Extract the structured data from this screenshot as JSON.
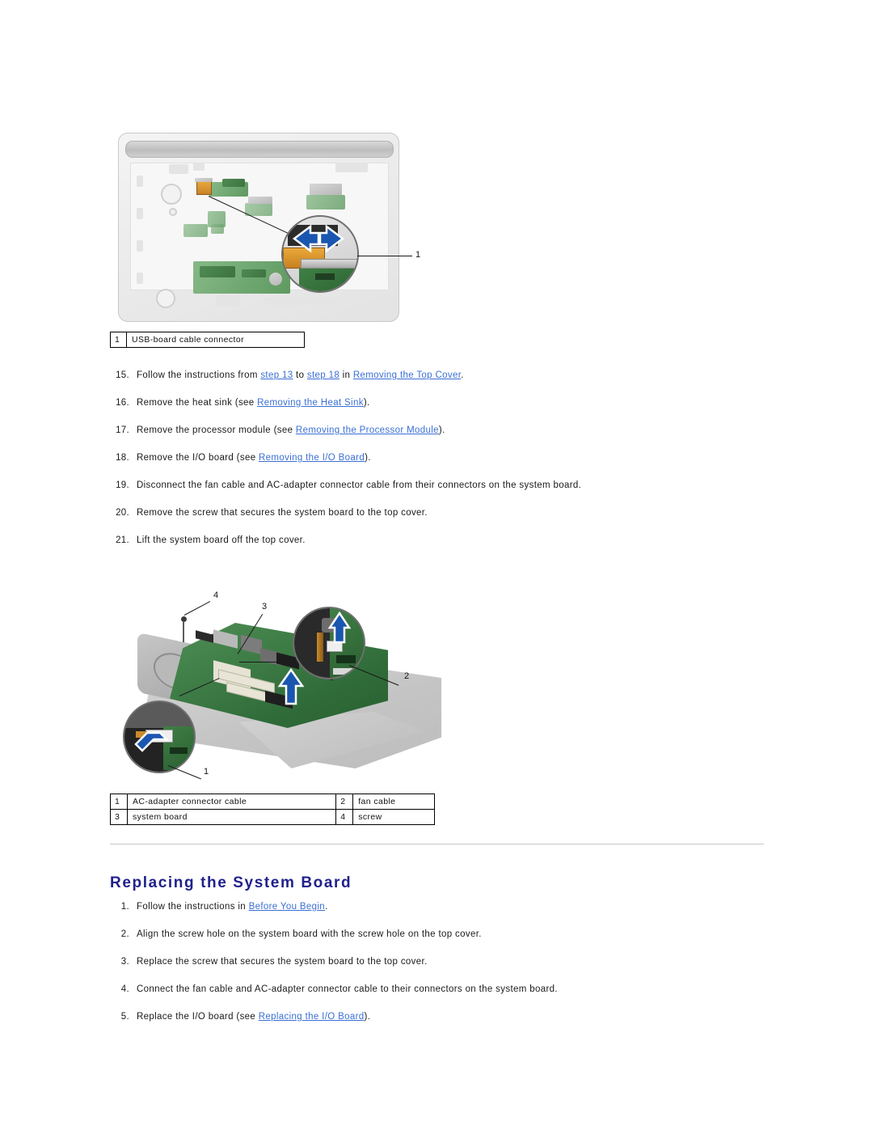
{
  "figure_one": {
    "caption_table": {
      "rows": [
        {
          "index": "1",
          "label": "USB-board cable connector"
        }
      ]
    },
    "callouts": [
      "1"
    ]
  },
  "removal_steps": [
    {
      "num": "15.",
      "segments": [
        {
          "type": "text",
          "text": "Follow the instructions from "
        },
        {
          "type": "link",
          "text": "step 13"
        },
        {
          "type": "text",
          "text": " to "
        },
        {
          "type": "link",
          "text": "step 18"
        },
        {
          "type": "text",
          "text": " in "
        },
        {
          "type": "link",
          "text": "Removing the Top Cover"
        },
        {
          "type": "text",
          "text": "."
        }
      ]
    },
    {
      "num": "16.",
      "segments": [
        {
          "type": "text",
          "text": "Remove the heat sink (see "
        },
        {
          "type": "link",
          "text": "Removing the Heat Sink"
        },
        {
          "type": "text",
          "text": ")."
        }
      ]
    },
    {
      "num": "17.",
      "segments": [
        {
          "type": "text",
          "text": "Remove the processor module (see "
        },
        {
          "type": "link",
          "text": "Removing the Processor Module"
        },
        {
          "type": "text",
          "text": ")."
        }
      ]
    },
    {
      "num": "18.",
      "segments": [
        {
          "type": "text",
          "text": "Remove the I/O board (see "
        },
        {
          "type": "link",
          "text": "Removing the I/O Board"
        },
        {
          "type": "text",
          "text": ")."
        }
      ]
    },
    {
      "num": "19.",
      "segments": [
        {
          "type": "text",
          "text": "Disconnect the fan cable and AC-adapter connector cable from their connectors on the system board."
        }
      ]
    },
    {
      "num": "20.",
      "segments": [
        {
          "type": "text",
          "text": "Remove the screw that secures the system board to the top cover."
        }
      ]
    },
    {
      "num": "21.",
      "segments": [
        {
          "type": "text",
          "text": "Lift the system board off the top cover."
        }
      ]
    }
  ],
  "figure_two": {
    "caption_table": {
      "rows": [
        {
          "left_index": "1",
          "left_label": "AC-adapter connector cable",
          "right_index": "2",
          "right_label": "fan cable"
        },
        {
          "left_index": "3",
          "left_label": "system board",
          "right_index": "4",
          "right_label": "screw"
        }
      ]
    },
    "callouts": [
      "1",
      "2",
      "3",
      "4"
    ]
  },
  "section": {
    "heading": "Replacing the System Board"
  },
  "replacing_steps": [
    {
      "num": "1.",
      "segments": [
        {
          "type": "text",
          "text": "Follow the instructions in "
        },
        {
          "type": "link",
          "text": "Before You Begin"
        },
        {
          "type": "text",
          "text": "."
        }
      ]
    },
    {
      "num": "2.",
      "segments": [
        {
          "type": "text",
          "text": "Align the screw hole on the system board with the screw hole on the top cover."
        }
      ]
    },
    {
      "num": "3.",
      "segments": [
        {
          "type": "text",
          "text": "Replace the screw that secures the system board to the top cover."
        }
      ]
    },
    {
      "num": "4.",
      "segments": [
        {
          "type": "text",
          "text": "Connect the fan cable and AC-adapter connector cable to their connectors on the system board."
        }
      ]
    },
    {
      "num": "5.",
      "segments": [
        {
          "type": "text",
          "text": "Replace the I/O board (see "
        },
        {
          "type": "link",
          "text": "Replacing the I/O Board"
        },
        {
          "type": "text",
          "text": ")."
        }
      ]
    }
  ],
  "colors": {
    "heading": "#21218c",
    "link": "#3b6fd4",
    "body_text": "#1a1a1a",
    "rule": "#c8c8c8",
    "arrow_blue": "#1a56b0",
    "pcb_green": "#4f8f55",
    "ribbon_orange": "#e8a93c"
  }
}
